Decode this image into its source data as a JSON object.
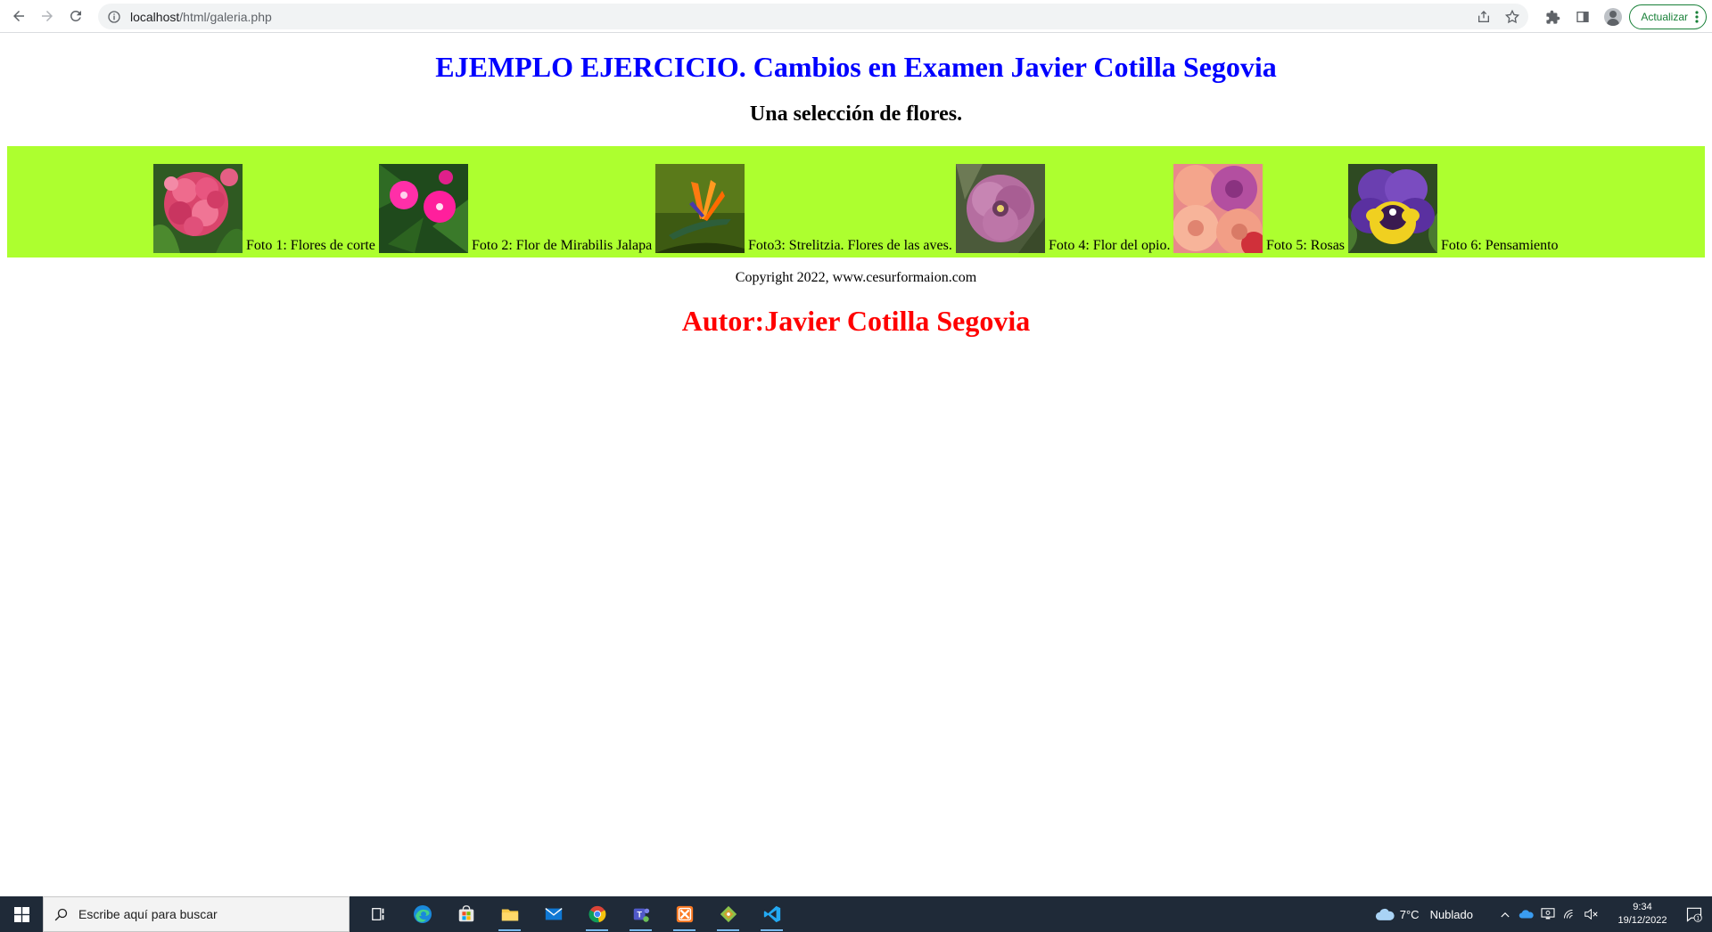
{
  "browser": {
    "url_host": "localhost",
    "url_path": "/html/galeria.php",
    "update_label": "Actualizar"
  },
  "page": {
    "title": "EJEMPLO EJERCICIO. Cambios en Examen Javier Cotilla Segovia",
    "subtitle": "Una selección de flores.",
    "gallery_background": "#adff2f",
    "photos": [
      {
        "caption": "Foto 1: Flores de corte"
      },
      {
        "caption": "Foto 2: Flor de Mirabilis Jalapa"
      },
      {
        "caption": "Foto3: Strelitzia. Flores de las aves."
      },
      {
        "caption": "Foto 4: Flor del opio."
      },
      {
        "caption": "Foto 5: Rosas"
      },
      {
        "caption": "Foto 6: Pensamiento"
      }
    ],
    "copyright": "Copyright 2022, www.cesurformaion.com",
    "author": "Autor:Javier Cotilla Segovia",
    "title_color": "#0000ff",
    "author_color": "#ff0000"
  },
  "taskbar": {
    "search_placeholder": "Escribe aquí para buscar",
    "weather_temp": "7°C",
    "weather_text": "Nublado",
    "time": "9:34",
    "date": "19/12/2022",
    "notification_count": "1",
    "apps": [
      "task-view-icon",
      "edge-icon",
      "store-icon",
      "file-explorer-icon",
      "mail-icon",
      "chrome-icon",
      "teams-icon",
      "xampp-icon",
      "git-icon",
      "vscode-icon"
    ]
  }
}
